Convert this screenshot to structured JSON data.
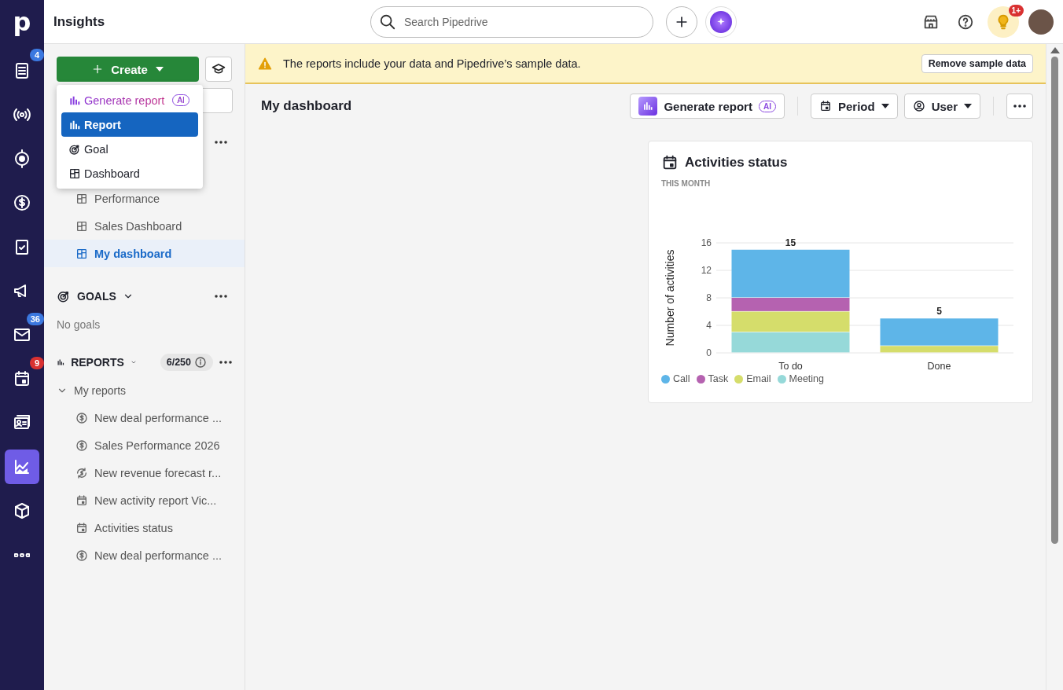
{
  "rail": {
    "logo": "p",
    "items": [
      {
        "badge": "4",
        "selected": false
      },
      {
        "selected": false
      },
      {
        "selected": false
      },
      {
        "selected": false
      },
      {
        "selected": false
      },
      {
        "selected": false
      },
      {
        "badge": "36",
        "selected": false
      },
      {
        "badge": "9",
        "selected": false
      },
      {
        "selected": false
      },
      {
        "selected": true
      },
      {
        "selected": false
      },
      {
        "selected": false
      }
    ]
  },
  "topbar": {
    "title": "Insights",
    "search": {
      "placeholder": "Search Pipedrive"
    },
    "notification_badge": "1+"
  },
  "sidebar": {
    "create_button": "Create",
    "create_menu": [
      {
        "kind": "ai",
        "label": "Generate report",
        "badge": "AI",
        "selected": false
      },
      {
        "kind": "report",
        "label": "Report",
        "selected": true
      },
      {
        "kind": "goal",
        "label": "Goal",
        "selected": false
      },
      {
        "kind": "dashboard",
        "label": "Dashboard",
        "selected": false
      }
    ],
    "dashboards": [
      {
        "label": "Performance",
        "selected": false
      },
      {
        "label": "Sales Dashboard",
        "selected": false
      },
      {
        "label": "My dashboard",
        "selected": true
      }
    ],
    "goals": {
      "title": "GOALS",
      "empty": "No goals"
    },
    "reports": {
      "title": "REPORTS",
      "count": "6/250",
      "group": "My reports",
      "expanded": true,
      "items": [
        {
          "kind": "deal",
          "label": "New deal performance ..."
        },
        {
          "kind": "deal",
          "label": "Sales Performance 2026"
        },
        {
          "kind": "forecast",
          "label": "New revenue forecast r..."
        },
        {
          "kind": "activity",
          "label": "New activity report Vic..."
        },
        {
          "kind": "activity",
          "label": "Activities status"
        },
        {
          "kind": "deal",
          "label": "New deal performance ..."
        }
      ]
    }
  },
  "banner": {
    "text": "The reports include your data and Pipedrive’s sample data.",
    "button": "Remove sample data"
  },
  "dashboard": {
    "title": "My dashboard",
    "generate_button": "Generate report",
    "generate_badge": "AI",
    "period_button": "Period",
    "user_button": "User"
  },
  "card": {
    "title": "Activities status",
    "subtitle": "THIS MONTH",
    "chart_data": {
      "type": "bar",
      "stacked": true,
      "orientation": "vertical",
      "ylabel": "Number of activities",
      "categories": [
        "To do",
        "Done"
      ],
      "series": [
        {
          "name": "Call",
          "color": "#5eb5e8",
          "values": [
            7,
            4
          ]
        },
        {
          "name": "Task",
          "color": "#b562b0",
          "values": [
            2,
            0
          ]
        },
        {
          "name": "Email",
          "color": "#d5dd6b",
          "values": [
            3,
            1
          ]
        },
        {
          "name": "Meeting",
          "color": "#96d9d9",
          "values": [
            3,
            0
          ]
        }
      ],
      "grid": true,
      "ylim": [
        0,
        16
      ],
      "yticks": [
        0,
        4,
        8,
        12,
        16
      ],
      "value_labels": [
        "15",
        "5"
      ]
    }
  }
}
